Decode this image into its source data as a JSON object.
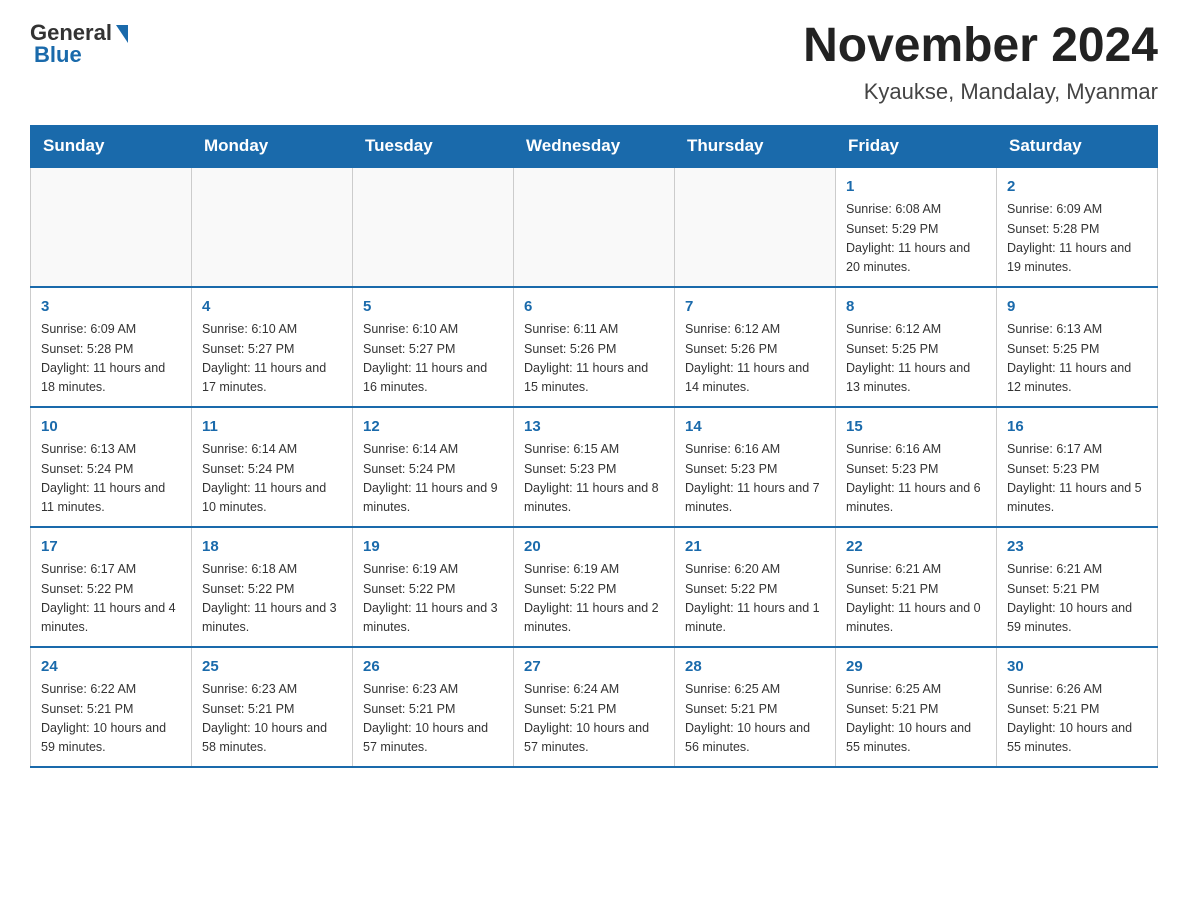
{
  "logo": {
    "general": "General",
    "blue": "Blue"
  },
  "title": "November 2024",
  "subtitle": "Kyaukse, Mandalay, Myanmar",
  "days_of_week": [
    "Sunday",
    "Monday",
    "Tuesday",
    "Wednesday",
    "Thursday",
    "Friday",
    "Saturday"
  ],
  "weeks": [
    [
      {
        "day": "",
        "info": ""
      },
      {
        "day": "",
        "info": ""
      },
      {
        "day": "",
        "info": ""
      },
      {
        "day": "",
        "info": ""
      },
      {
        "day": "",
        "info": ""
      },
      {
        "day": "1",
        "info": "Sunrise: 6:08 AM\nSunset: 5:29 PM\nDaylight: 11 hours and 20 minutes."
      },
      {
        "day": "2",
        "info": "Sunrise: 6:09 AM\nSunset: 5:28 PM\nDaylight: 11 hours and 19 minutes."
      }
    ],
    [
      {
        "day": "3",
        "info": "Sunrise: 6:09 AM\nSunset: 5:28 PM\nDaylight: 11 hours and 18 minutes."
      },
      {
        "day": "4",
        "info": "Sunrise: 6:10 AM\nSunset: 5:27 PM\nDaylight: 11 hours and 17 minutes."
      },
      {
        "day": "5",
        "info": "Sunrise: 6:10 AM\nSunset: 5:27 PM\nDaylight: 11 hours and 16 minutes."
      },
      {
        "day": "6",
        "info": "Sunrise: 6:11 AM\nSunset: 5:26 PM\nDaylight: 11 hours and 15 minutes."
      },
      {
        "day": "7",
        "info": "Sunrise: 6:12 AM\nSunset: 5:26 PM\nDaylight: 11 hours and 14 minutes."
      },
      {
        "day": "8",
        "info": "Sunrise: 6:12 AM\nSunset: 5:25 PM\nDaylight: 11 hours and 13 minutes."
      },
      {
        "day": "9",
        "info": "Sunrise: 6:13 AM\nSunset: 5:25 PM\nDaylight: 11 hours and 12 minutes."
      }
    ],
    [
      {
        "day": "10",
        "info": "Sunrise: 6:13 AM\nSunset: 5:24 PM\nDaylight: 11 hours and 11 minutes."
      },
      {
        "day": "11",
        "info": "Sunrise: 6:14 AM\nSunset: 5:24 PM\nDaylight: 11 hours and 10 minutes."
      },
      {
        "day": "12",
        "info": "Sunrise: 6:14 AM\nSunset: 5:24 PM\nDaylight: 11 hours and 9 minutes."
      },
      {
        "day": "13",
        "info": "Sunrise: 6:15 AM\nSunset: 5:23 PM\nDaylight: 11 hours and 8 minutes."
      },
      {
        "day": "14",
        "info": "Sunrise: 6:16 AM\nSunset: 5:23 PM\nDaylight: 11 hours and 7 minutes."
      },
      {
        "day": "15",
        "info": "Sunrise: 6:16 AM\nSunset: 5:23 PM\nDaylight: 11 hours and 6 minutes."
      },
      {
        "day": "16",
        "info": "Sunrise: 6:17 AM\nSunset: 5:23 PM\nDaylight: 11 hours and 5 minutes."
      }
    ],
    [
      {
        "day": "17",
        "info": "Sunrise: 6:17 AM\nSunset: 5:22 PM\nDaylight: 11 hours and 4 minutes."
      },
      {
        "day": "18",
        "info": "Sunrise: 6:18 AM\nSunset: 5:22 PM\nDaylight: 11 hours and 3 minutes."
      },
      {
        "day": "19",
        "info": "Sunrise: 6:19 AM\nSunset: 5:22 PM\nDaylight: 11 hours and 3 minutes."
      },
      {
        "day": "20",
        "info": "Sunrise: 6:19 AM\nSunset: 5:22 PM\nDaylight: 11 hours and 2 minutes."
      },
      {
        "day": "21",
        "info": "Sunrise: 6:20 AM\nSunset: 5:22 PM\nDaylight: 11 hours and 1 minute."
      },
      {
        "day": "22",
        "info": "Sunrise: 6:21 AM\nSunset: 5:21 PM\nDaylight: 11 hours and 0 minutes."
      },
      {
        "day": "23",
        "info": "Sunrise: 6:21 AM\nSunset: 5:21 PM\nDaylight: 10 hours and 59 minutes."
      }
    ],
    [
      {
        "day": "24",
        "info": "Sunrise: 6:22 AM\nSunset: 5:21 PM\nDaylight: 10 hours and 59 minutes."
      },
      {
        "day": "25",
        "info": "Sunrise: 6:23 AM\nSunset: 5:21 PM\nDaylight: 10 hours and 58 minutes."
      },
      {
        "day": "26",
        "info": "Sunrise: 6:23 AM\nSunset: 5:21 PM\nDaylight: 10 hours and 57 minutes."
      },
      {
        "day": "27",
        "info": "Sunrise: 6:24 AM\nSunset: 5:21 PM\nDaylight: 10 hours and 57 minutes."
      },
      {
        "day": "28",
        "info": "Sunrise: 6:25 AM\nSunset: 5:21 PM\nDaylight: 10 hours and 56 minutes."
      },
      {
        "day": "29",
        "info": "Sunrise: 6:25 AM\nSunset: 5:21 PM\nDaylight: 10 hours and 55 minutes."
      },
      {
        "day": "30",
        "info": "Sunrise: 6:26 AM\nSunset: 5:21 PM\nDaylight: 10 hours and 55 minutes."
      }
    ]
  ]
}
